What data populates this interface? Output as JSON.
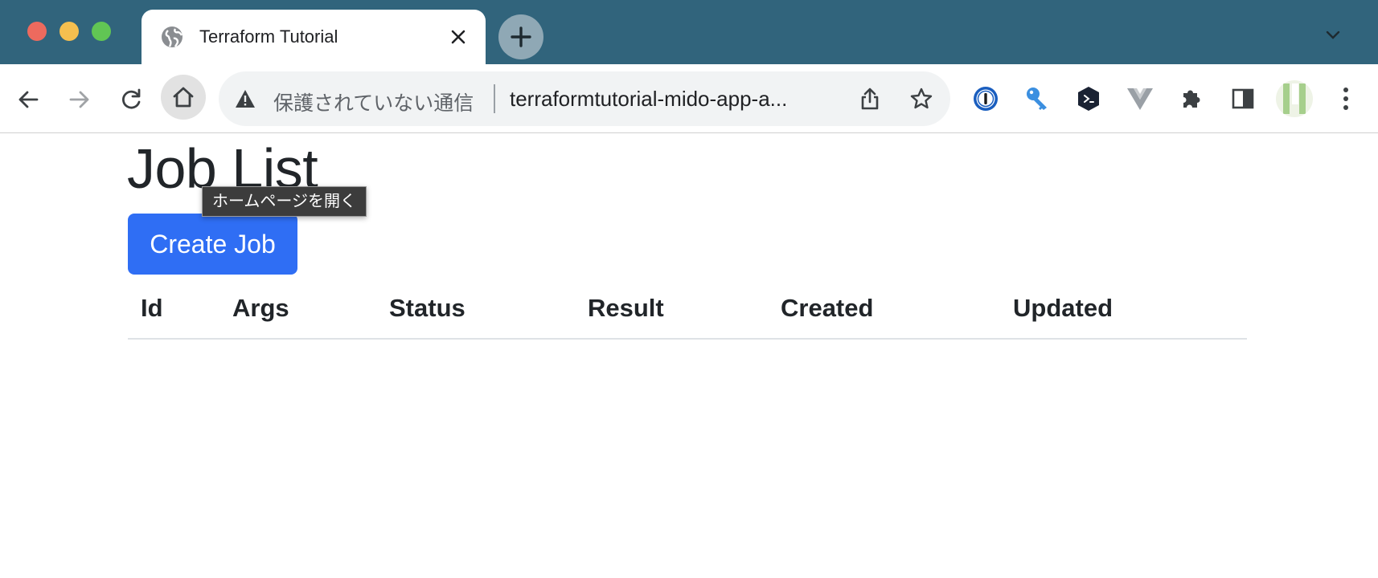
{
  "browser": {
    "tab": {
      "title": "Terraform Tutorial",
      "favicon": "globe-icon"
    },
    "toolbar": {
      "security_label": "保護されていない通信",
      "url": "terraformtutorial-mido-app-a..."
    },
    "tooltip": "ホームページを開く",
    "extensions": [
      "1password-icon",
      "key-icon",
      "terminal-extension-icon",
      "vue-devtools-icon",
      "extensions-puzzle-icon",
      "side-panel-icon"
    ],
    "colors": {
      "tabstrip": "#31647c",
      "accent_button": "#2f6ef4"
    }
  },
  "page": {
    "title": "Job List",
    "create_button": "Create Job",
    "table": {
      "headers": [
        "Id",
        "Args",
        "Status",
        "Result",
        "Created",
        "Updated"
      ],
      "rows": []
    }
  }
}
